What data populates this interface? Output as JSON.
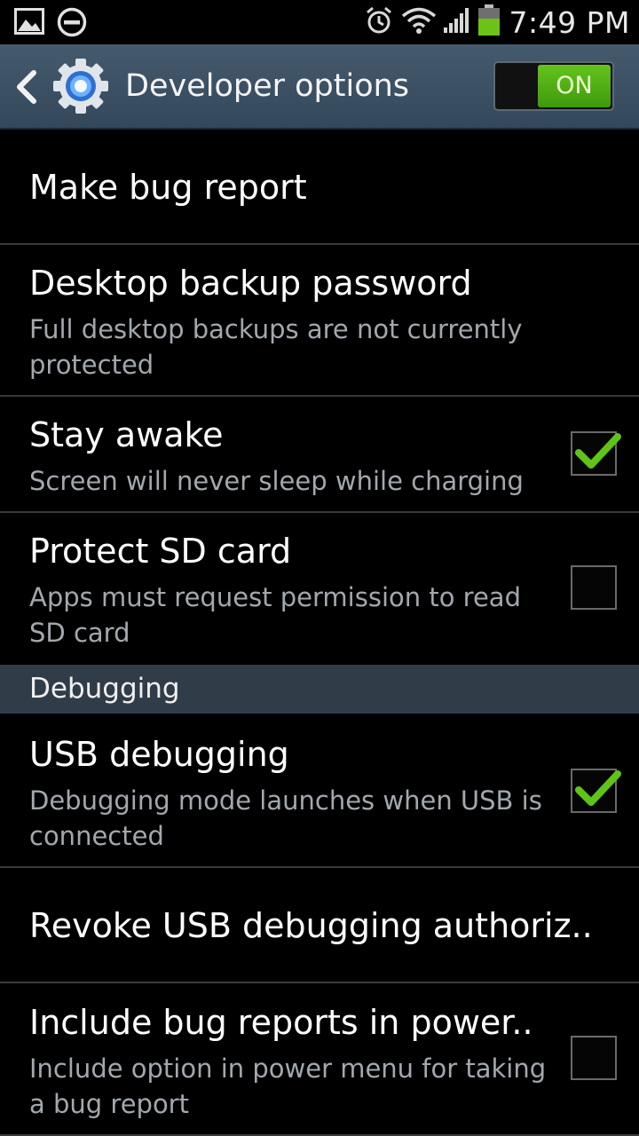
{
  "status_bar": {
    "time": "7:49 PM",
    "left_icons": [
      "gallery-icon",
      "do-not-disturb-icon"
    ],
    "right_icons": [
      "alarm-icon",
      "wifi-icon",
      "signal-icon",
      "battery-icon"
    ]
  },
  "action_bar": {
    "title": "Developer options",
    "switch_label": "ON",
    "switch_state": "on",
    "accent_color": "#4fb015"
  },
  "settings": {
    "make_bug_report": {
      "title": "Make bug report"
    },
    "desktop_backup_password": {
      "title": "Desktop backup password",
      "summary": "Full desktop backups are not currently protected"
    },
    "stay_awake": {
      "title": "Stay awake",
      "summary": "Screen will never sleep while charging",
      "checked": true
    },
    "protect_sd_card": {
      "title": "Protect SD card",
      "summary": "Apps must request permission to read SD card",
      "checked": false
    },
    "debugging_header": "Debugging",
    "usb_debugging": {
      "title": "USB debugging",
      "summary": "Debugging mode launches when USB is connected",
      "checked": true
    },
    "revoke_usb": {
      "title": "Revoke USB debugging authoriz.."
    },
    "include_bug_reports": {
      "title": "Include bug reports in power..",
      "summary": "Include option in power menu for taking a bug report",
      "checked": false
    }
  }
}
